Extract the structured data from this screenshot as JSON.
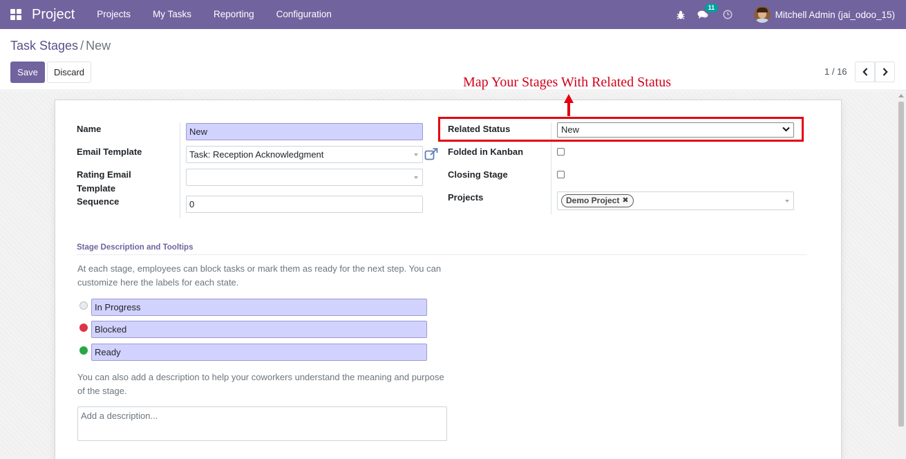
{
  "navbar": {
    "app_name": "Project",
    "menu": [
      "Projects",
      "My Tasks",
      "Reporting",
      "Configuration"
    ],
    "messages_count": "11",
    "user_name": "Mitchell Admin (jai_odoo_15)",
    "brand_color": "#71639e"
  },
  "breadcrumb": {
    "parent": "Task Stages",
    "separator": "/",
    "current": "New"
  },
  "buttons": {
    "save": "Save",
    "discard": "Discard"
  },
  "pager": {
    "value": "1 / 16"
  },
  "form": {
    "name_label": "Name",
    "name_value": "New",
    "email_template_label": "Email Template",
    "email_template_value": "Task: Reception Acknowledgment",
    "rating_template_label_1": "Rating Email",
    "rating_template_label_2": "Template",
    "rating_template_value": "",
    "sequence_label": "Sequence",
    "sequence_value": "0",
    "related_status_label": "Related Status",
    "related_status_value": "New",
    "folded_label": "Folded in Kanban",
    "folded_checked": false,
    "closing_label": "Closing Stage",
    "closing_checked": false,
    "projects_label": "Projects",
    "projects_tags": [
      "Demo Project"
    ]
  },
  "annotation": {
    "text": "Map Your Stages With Related Status",
    "color": "#e3000f"
  },
  "section": {
    "title": "Stage Description and Tooltips",
    "help_1": "At each stage, employees can block tasks or mark them as ready for the next step. You can customize here the labels for each state.",
    "states": [
      {
        "color": "grey",
        "label": "In Progress"
      },
      {
        "color": "red",
        "label": "Blocked"
      },
      {
        "color": "green",
        "label": "Ready"
      }
    ],
    "help_2": "You can also add a description to help your coworkers understand the meaning and purpose of the stage.",
    "description_placeholder": "Add a description..."
  }
}
